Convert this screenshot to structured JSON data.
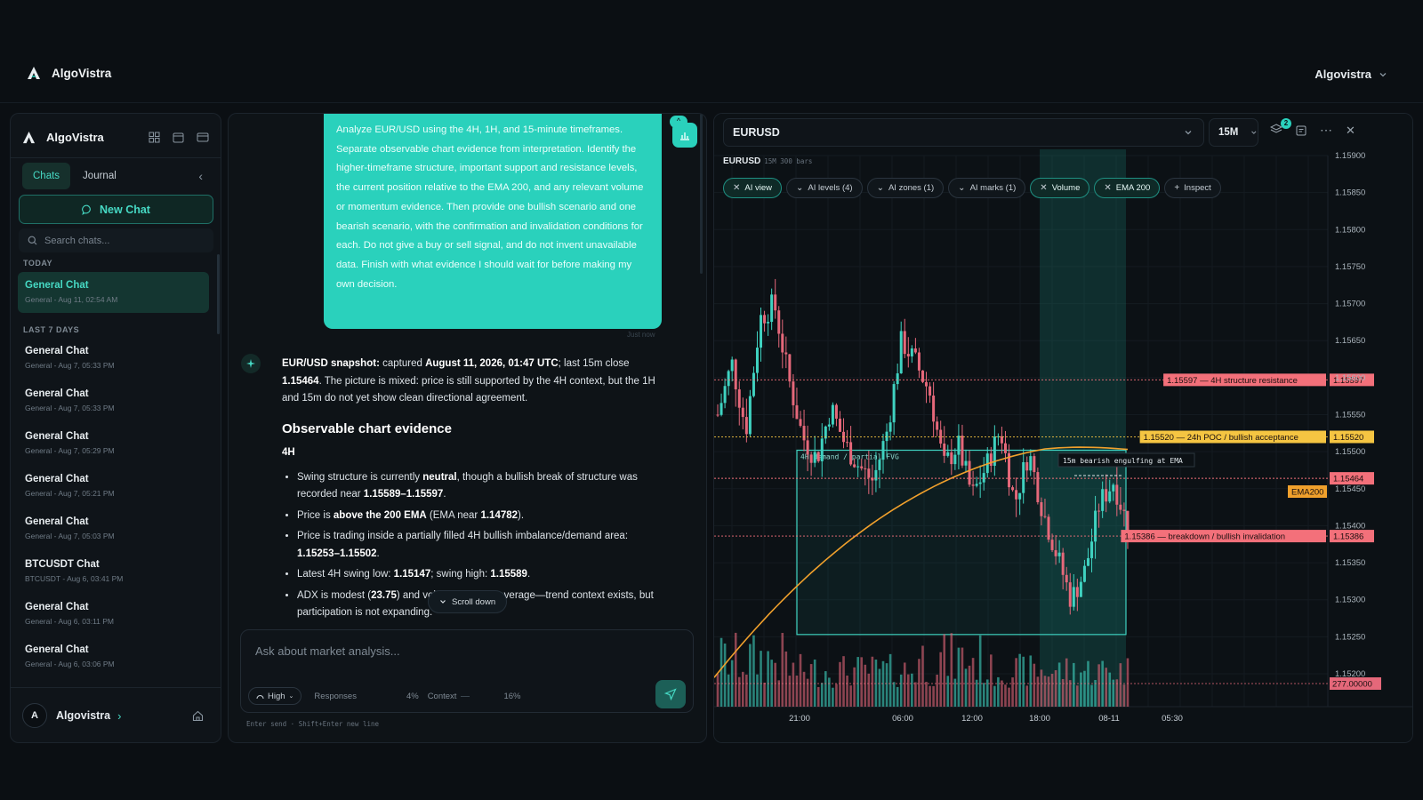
{
  "app": {
    "name": "AlgoVistra",
    "user": "Algovistra"
  },
  "sidebar": {
    "brand": "AlgoVistra",
    "tabs": [
      "Chats",
      "Journal"
    ],
    "new_chat": "New Chat",
    "search_placeholder": "Search chats...",
    "section_today": "TODAY",
    "section_last7": "LAST 7 DAYS",
    "today": [
      {
        "title": "General Chat",
        "sub": "General - Aug 11, 02:54 AM"
      }
    ],
    "last7": [
      {
        "title": "General Chat",
        "sub": "General - Aug 7, 05:33 PM"
      },
      {
        "title": "General Chat",
        "sub": "General - Aug 7, 05:33 PM"
      },
      {
        "title": "General Chat",
        "sub": "General - Aug 7, 05:29 PM"
      },
      {
        "title": "General Chat",
        "sub": "General - Aug 7, 05:21 PM"
      },
      {
        "title": "General Chat",
        "sub": "General - Aug 7, 05:03 PM"
      },
      {
        "title": "BTCUSDT Chat",
        "sub": "BTCUSDT - Aug 6, 03:41 PM"
      },
      {
        "title": "General Chat",
        "sub": "General - Aug 6, 03:11 PM"
      },
      {
        "title": "General Chat",
        "sub": "General - Aug 6, 03:06 PM"
      }
    ],
    "footer_user": "Algovistra",
    "footer_initial": "A"
  },
  "chat": {
    "user_message": "Analyze EUR/USD using the 4H, 1H, and 15-minute timeframes. Separate observable chart evidence from interpretation. Identify the higher-timeframe structure, important support and resistance levels, the current position relative to the EMA 200, and any relevant volume or momentum evidence. Then provide one bullish scenario and one bearish scenario, with the confirmation and invalidation conditions for each. Do not give a buy or sell signal, and do not invent unavailable data. Finish with what evidence I should wait for before making my own decision.",
    "message_time": "Just now",
    "answer": {
      "snap_label": "EUR/USD snapshot:",
      "snap_text1": " captured ",
      "snap_date": "August 11, 2026, 01:47 UTC",
      "snap_text2": "; last 15m close ",
      "snap_close": "1.15464",
      "snap_text3": ". The picture is mixed: price is still supported by the 4H context, but the 1H and 15m do not yet show clean directional agreement.",
      "h2": "Observable chart evidence",
      "h3": "4H",
      "b1_pre": "Swing structure is currently ",
      "b1_bold": "neutral",
      "b1_mid": ", though a bullish break of structure was recorded near ",
      "b1_range": "1.15589–1.15597",
      "b1_end": ".",
      "b2_pre": "Price is ",
      "b2_bold": "above the 200 EMA",
      "b2_end": " (EMA near ",
      "b2_val": "1.14782",
      "b2_close": ").",
      "b3_pre": "Price is trading inside a partially filled 4H bullish imbalance/demand area: ",
      "b3_range": "1.15253–1.15502",
      "b3_end": ".",
      "b4_pre": "Latest 4H swing low: ",
      "b4_low": "1.15147",
      "b4_mid": "; swing high: ",
      "b4_high": "1.15589",
      "b4_end": ".",
      "b5_pre": "ADX is modest (",
      "b5_val": "23.75",
      "b5_end": ") and ",
      "b5_hidden": "volume is below average",
      "b5_tail": "—trend context exists, but participation is not expanding."
    },
    "scroll_down": "Scroll down",
    "input_placeholder": "Ask about market analysis...",
    "effort": "High",
    "responses_label": "Responses",
    "responses_pct": "4%",
    "context_label": "Context",
    "context_pct": "16%",
    "hint": "Enter send · Shift+Enter new line"
  },
  "chart_panel": {
    "symbol": "EURUSD",
    "timeframe": "15M",
    "subtitle_symbol": "EURUSD",
    "subtitle_meta": "15M  300 bars",
    "layers_badge": "2",
    "chips": [
      {
        "label": "AI view",
        "icon": "x",
        "on": true
      },
      {
        "label": "AI levels (4)",
        "icon": "v",
        "on": false
      },
      {
        "label": "AI zones (1)",
        "icon": "v",
        "on": false
      },
      {
        "label": "AI marks (1)",
        "icon": "v",
        "on": false
      },
      {
        "label": "Volume",
        "icon": "x",
        "on": true
      },
      {
        "label": "EMA 200",
        "icon": "x",
        "on": true
      },
      {
        "label": "Inspect",
        "icon": "+",
        "on": false
      }
    ]
  },
  "chart_data": {
    "type": "candlestick",
    "symbol": "EURUSD",
    "timeframe": "15M",
    "ylim": [
      1.152,
      1.159
    ],
    "y_ticks": [
      "1.15900",
      "1.15850",
      "1.15800",
      "1.15750",
      "1.15700",
      "1.15650",
      "1.15600",
      "1.15550",
      "1.15500",
      "1.15450",
      "1.15400",
      "1.15350",
      "1.15300",
      "1.15250",
      "1.15200"
    ],
    "x_ticks": [
      "21:00",
      "06:00",
      "12:00",
      "18:00",
      "08-11",
      "05:30"
    ],
    "close_path": [
      1.1555,
      1.1562,
      1.1553,
      1.1568,
      1.157,
      1.156,
      1.1552,
      1.1549,
      1.1556,
      1.1551,
      1.1548,
      1.1546,
      1.1553,
      1.1565,
      1.1562,
      1.1558,
      1.1548,
      1.1551,
      1.1544,
      1.1548,
      1.1553,
      1.1543,
      1.155,
      1.1542,
      1.1536,
      1.153,
      1.1534,
      1.1543,
      1.1546,
      1.154
    ],
    "levels": [
      {
        "price": 1.15597,
        "label": "1.15597 — 4H structure resistance",
        "tag": "1.15597",
        "color": "#f3707a"
      },
      {
        "price": 1.1552,
        "label": "1.15520 — 24h POC / bullish acceptance",
        "tag": "1.15520",
        "color": "#f5c542"
      },
      {
        "price": 1.15464,
        "label": "",
        "tag": "1.15464",
        "color": "#f3707a"
      },
      {
        "price": 1.15386,
        "label": "1.15386 — breakdown / bullish invalidation",
        "tag": "1.15386",
        "color": "#f3707a"
      }
    ],
    "ema_tag": "EMA200",
    "volume_tag": "277.00000",
    "zone": {
      "label": "4H demand / partial FVG",
      "top": 1.15502,
      "bottom": 1.15253
    },
    "annotation": "15m bearish engulfing at EMA"
  }
}
